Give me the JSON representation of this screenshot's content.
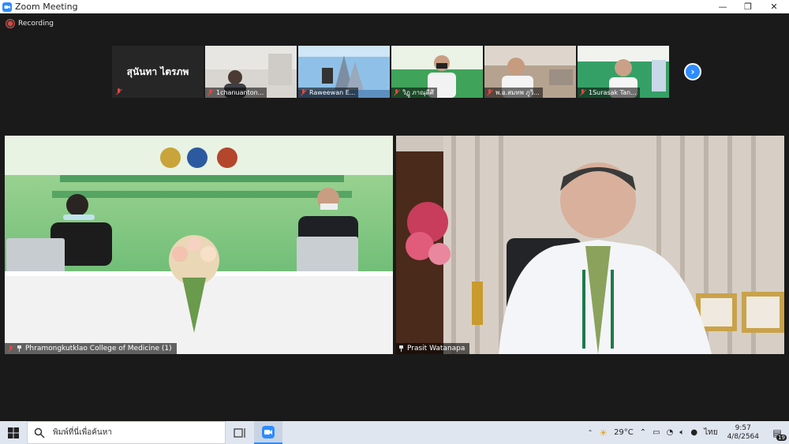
{
  "window": {
    "title": "Zoom Meeting",
    "controls": [
      "—",
      "❐",
      "✕"
    ]
  },
  "recording": {
    "label": "Recording"
  },
  "thumbnails": [
    {
      "name": "สุนันทา ไตรภพ",
      "kind": "name-only"
    },
    {
      "name": "1chanuanton...",
      "kind": "video"
    },
    {
      "name": "Raweewan E...",
      "kind": "video"
    },
    {
      "name": "วิฏู ภาณุดีศึ",
      "kind": "video"
    },
    {
      "name": "พ.อ.สมทพ ภูวิ...",
      "kind": "video"
    },
    {
      "name": "1Surasak Tan...",
      "kind": "video"
    }
  ],
  "next_page_icon": "chevron-right-icon",
  "main_videos": [
    {
      "name": "Phramongkutklao College of Medicine (1)",
      "muted": true
    },
    {
      "name": "Prasit Watanapa",
      "muted": false
    }
  ],
  "taskbar": {
    "search_placeholder": "พิมพ์ที่นี่เพื่อค้นหา",
    "weather": "29°C",
    "language": "ไทย",
    "time": "9:57",
    "date": "4/8/2564",
    "notification_count": "19"
  },
  "colors": {
    "accent": "#2d8cff",
    "muted_red": "#e0483f",
    "stage_bg": "#1a1a1a"
  }
}
